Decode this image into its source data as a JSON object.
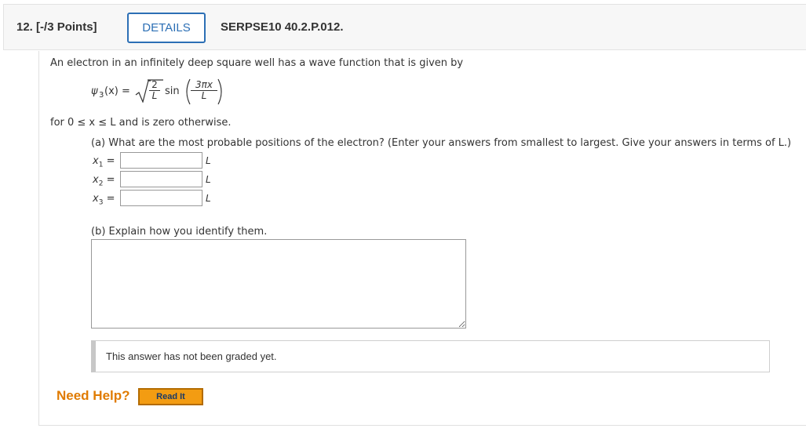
{
  "header": {
    "question_number": "12.",
    "points": "[-/3 Points]",
    "details_label": "DETAILS",
    "source": "SERPSE10 40.2.P.012."
  },
  "problem": {
    "intro": "An electron in an infinitely deep square well has a wave function that is given by",
    "psi_label": "ψ",
    "psi_sub": "3",
    "psi_arg": "(x) =",
    "frac_num": "2",
    "frac_den": "L",
    "sin_label": "sin",
    "arg_num": "3πx",
    "arg_den": "L",
    "condition": "for 0 ≤ x ≤ L and is zero otherwise."
  },
  "part_a": {
    "question": "(a) What are the most probable positions of the electron? (Enter your answers from smallest to largest. Give your answers in terms of L.)",
    "fields": [
      {
        "label": "x",
        "sub": "1",
        "value": "",
        "unit": "L"
      },
      {
        "label": "x",
        "sub": "2",
        "value": "",
        "unit": "L"
      },
      {
        "label": "x",
        "sub": "3",
        "value": "",
        "unit": "L"
      }
    ]
  },
  "part_b": {
    "question": "(b) Explain how you identify them.",
    "answer": "",
    "graded_status": "This answer has not been graded yet."
  },
  "help": {
    "need_help": "Need Help?",
    "read_it": "Read It"
  },
  "colors": {
    "details_blue": "#2c6fb5",
    "need_help_orange": "#e07b00",
    "read_it_bg": "#f39c12"
  }
}
